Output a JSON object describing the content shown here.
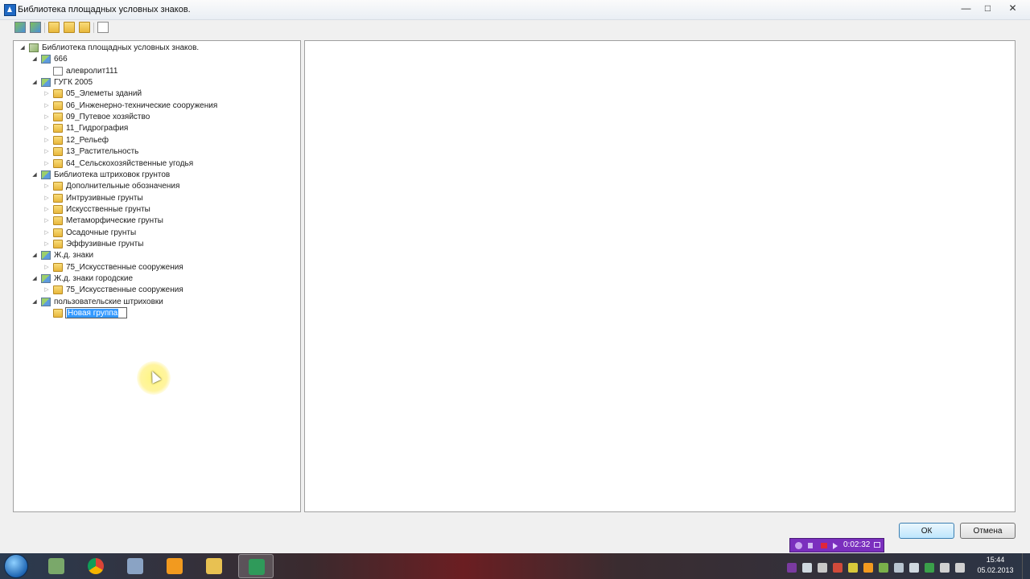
{
  "window": {
    "title": "Библиотека площадных условных знаков."
  },
  "tree": {
    "root": "Библиотека площадных условных знаков.",
    "libraries": [
      {
        "label": "666",
        "children": [
          {
            "label": "алевролит111",
            "kind": "symbol"
          }
        ]
      },
      {
        "label": "ГУГК 2005",
        "children": [
          {
            "label": "05_Элеметы зданий",
            "kind": "folder"
          },
          {
            "label": "06_Инженерно-технические сооружения",
            "kind": "folder"
          },
          {
            "label": "09_Путевое хозяйство",
            "kind": "folder"
          },
          {
            "label": "11_Гидрография",
            "kind": "folder"
          },
          {
            "label": "12_Рельеф",
            "kind": "folder"
          },
          {
            "label": "13_Растительность",
            "kind": "folder"
          },
          {
            "label": "64_Сельскохозяйственные угодья",
            "kind": "folder"
          }
        ]
      },
      {
        "label": "Библиотека штриховок грунтов",
        "children": [
          {
            "label": "Дополнительные обозначения",
            "kind": "folder"
          },
          {
            "label": "Интрузивные грунты",
            "kind": "folder"
          },
          {
            "label": "Искусственные грунты",
            "kind": "folder"
          },
          {
            "label": "Метаморфические грунты",
            "kind": "folder"
          },
          {
            "label": "Осадочные грунты",
            "kind": "folder"
          },
          {
            "label": "Эффузивные грунты",
            "kind": "folder"
          }
        ]
      },
      {
        "label": "Ж.д. знаки",
        "children": [
          {
            "label": "75_Искусственные сооружения",
            "kind": "folder"
          }
        ]
      },
      {
        "label": "Ж.д. знаки городские",
        "children": [
          {
            "label": "75_Искусственные сооружения",
            "kind": "folder"
          }
        ]
      },
      {
        "label": "пользовательские штриховки",
        "children": []
      }
    ],
    "editing_node": {
      "value": "Новая группа"
    }
  },
  "buttons": {
    "ok": "ОК",
    "cancel": "Отмена"
  },
  "recorder": {
    "time": "0:02:32"
  },
  "taskbar": {
    "clock_time": "15:44",
    "clock_date": "05.02.2013"
  },
  "colors": {
    "selection": "#3399ff",
    "recorder": "#7b2fbe"
  }
}
